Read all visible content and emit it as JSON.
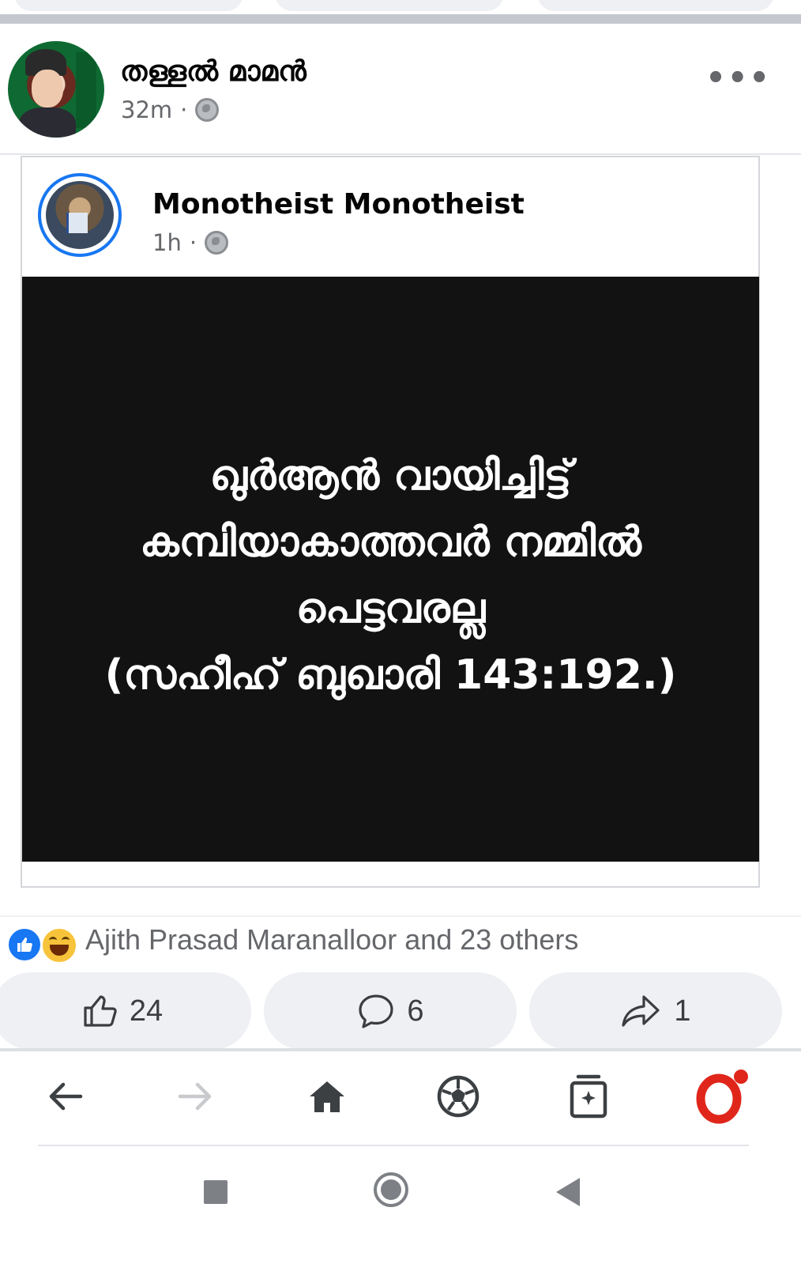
{
  "post": {
    "author": "തള്ളൽ മാമൻ",
    "time": "32m",
    "more_label": "•••"
  },
  "shared_post": {
    "author": "Monotheist Monotheist",
    "time": "1h",
    "quote_lines": [
      "ഖുർആൻ വായിച്ചിട്ട്",
      "കമ്പിയാകാത്തവർ നമ്മിൽ",
      "പെട്ടവരല്ല",
      "(സഹീഹ് ബുഖാരി 143:192.)"
    ]
  },
  "reactions": {
    "summary": "Ajith Prasad Maranalloor and 23 others"
  },
  "actions": {
    "like_count": "24",
    "comment_count": "6",
    "share_count": "1"
  },
  "browser_nav": {
    "items": [
      "back-icon",
      "forward-icon",
      "home-icon",
      "football-icon",
      "tabs-icon",
      "opera-menu-icon"
    ]
  },
  "colors": {
    "brand_blue": "#1877f2",
    "opera_red": "#e0261b",
    "post_background": "#121212"
  }
}
